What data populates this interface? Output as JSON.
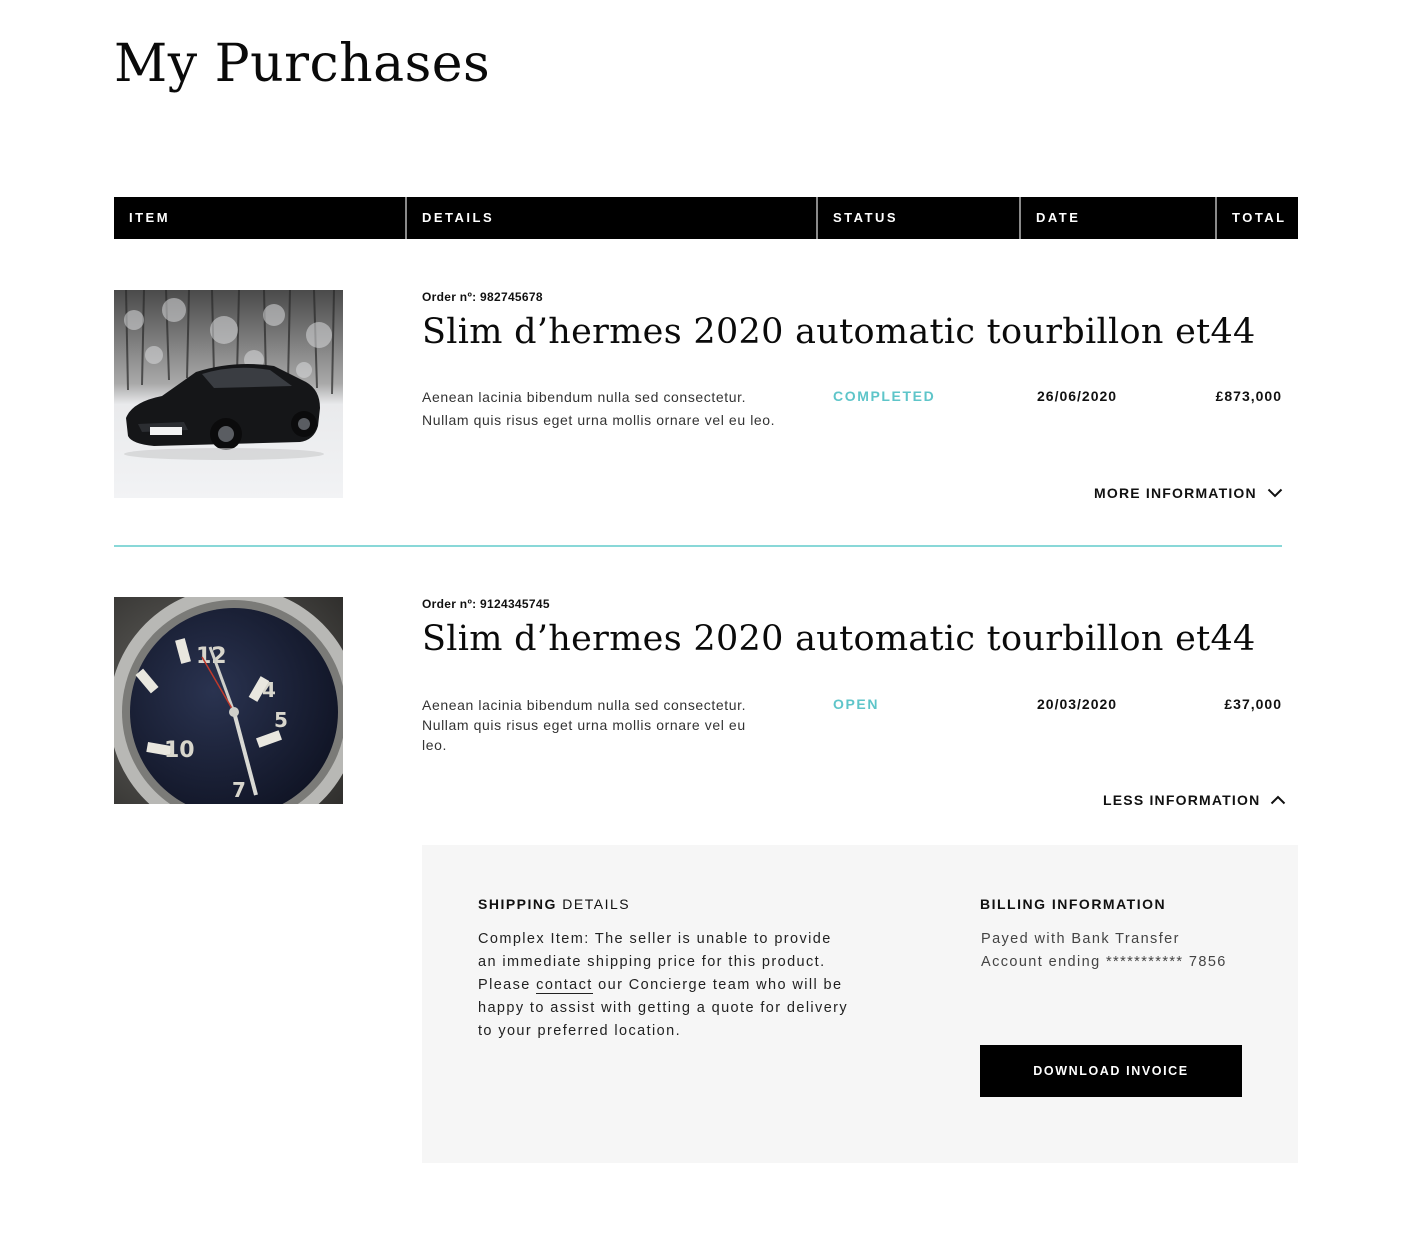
{
  "page": {
    "title": "My Purchases"
  },
  "table_header": {
    "columns": [
      "ITEM",
      "DETAILS",
      "STATUS",
      "DATE",
      "TOTAL"
    ]
  },
  "orders": [
    {
      "order_number": "Order nº: 982745678",
      "title": "Slim d’hermes 2020 automatic tourbillon et44",
      "description": "Aenean lacinia bibendum nulla sed consectetur. Nullam quis risus eget urna mollis ornare vel eu leo.",
      "status": "COMPLETED",
      "date": "26/06/2020",
      "total": "£873,000",
      "toggle_label": "MORE INFORMATION",
      "toggle_icon": "chevron-down-icon",
      "image": "sports-car-in-snow-photo"
    },
    {
      "order_number": "Order nº: 9124345745",
      "title": "Slim d’hermes 2020 automatic tourbillon et44",
      "description": "Aenean lacinia bibendum nulla sed consectetur. Nullam quis risus eget urna mollis ornare vel eu leo.",
      "status": "OPEN",
      "date": "20/03/2020",
      "total": "£37,000",
      "toggle_label": "LESS INFORMATION",
      "toggle_icon": "chevron-up-icon",
      "image": "wristwatch-closeup-photo"
    }
  ],
  "details_panel": {
    "shipping_heading_bold": "SHIPPING",
    "shipping_heading_rest": " DETAILS",
    "shipping_text_before_link": "Complex Item: The seller is unable to provide an immediate shipping price for this product. Please ",
    "shipping_link": "contact",
    "shipping_text_after_link": " our Concierge team who will be happy to assist with getting a quote for delivery to your preferred location.",
    "billing_heading": "BILLING INFORMATION",
    "billing_line1": "Payed with Bank Transfer",
    "billing_line2": "Account ending *********** 7856",
    "download_button": "DOWNLOAD INVOICE"
  },
  "colors": {
    "accent": "#5ec5c9",
    "divider": "#89d8d8",
    "header_bg": "#000000",
    "panel_bg": "#f6f6f6"
  }
}
